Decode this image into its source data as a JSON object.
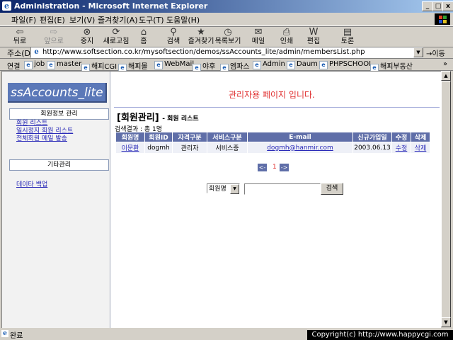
{
  "window": {
    "title": "Administration - Microsoft Internet Explorer"
  },
  "menubar": [
    "파일(F)",
    "편집(E)",
    "보기(V)",
    "즐겨찾기(A)",
    "도구(T)",
    "도움말(H)"
  ],
  "toolbar": [
    "뒤로",
    "앞으로",
    "중지",
    "새로고침",
    "홈",
    "검색",
    "즐겨찾기",
    "목록보기",
    "메일",
    "인쇄",
    "편집",
    "토론"
  ],
  "address": {
    "label": "주소(D)",
    "url": "http://www.softsection.co.kr/mysoftsection/demos/ssAccounts_lite/admin/membersList.php",
    "go": "이동"
  },
  "links": [
    "연결",
    "job",
    "master",
    "해피CGI",
    "해피몰",
    "WebMail",
    "야후",
    "엠파스",
    "Admin",
    "Daum",
    "PHPSCHOOL",
    "해피부동산"
  ],
  "sidebar": {
    "logo": "ssAccounts_lite",
    "section1": "회원정보 관리",
    "items": [
      "회원 리스트",
      "일시정지 회원 리스트",
      "전체회원 메일 발송"
    ],
    "section2": "기타관리",
    "items2": [
      "데이타 백업"
    ]
  },
  "main": {
    "notice": "관리자용 페이지 입니다.",
    "title": "[회원관리]",
    "subtitle": "- 회원 리스트",
    "result": "검색결과 : 총 1명",
    "table": {
      "headers": [
        "회원명",
        "회원ID",
        "자격구분",
        "서비스구분",
        "E-mail",
        "신규가입일",
        "수정",
        "삭제"
      ],
      "rows": [
        [
          "이문환",
          "dogmh",
          "관리자",
          "서비스중",
          "dogmh@hanmir.com",
          "2003.06.13",
          "수정",
          "삭제"
        ]
      ]
    },
    "pager": {
      "prev": "<-",
      "page": "1",
      "next": "->"
    },
    "search": {
      "select": "회원명",
      "value": "",
      "button": "검색"
    }
  },
  "status": {
    "text": "완료"
  },
  "copyright": "Copyright(c) http://www.happycgi.com"
}
